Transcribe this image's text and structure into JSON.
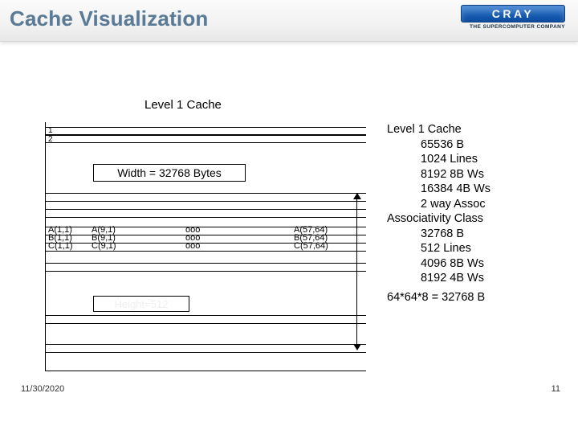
{
  "header": {
    "title": "Cache Visualization",
    "logo_text": "CRAY",
    "logo_sub": "The Supercomputer Company"
  },
  "diagram": {
    "caption": "Level 1 Cache",
    "row_numbers": [
      "1",
      "2"
    ],
    "width_label": "Width = 32768 Bytes",
    "height_label": "Height=512",
    "ellipsis": "ooo",
    "cells_left": [
      "A(1,1)",
      "B(1,1)",
      "C(1,1)"
    ],
    "cells_left2": [
      "A(9,1)",
      "B(9,1)",
      "C(9,1)"
    ],
    "cells_right": [
      "A(57,64)",
      "B(57,64)",
      "C(57,64)"
    ]
  },
  "info": {
    "heading1": "Level 1 Cache",
    "l1_size": "65536 B",
    "l1_lines": "1024 Lines",
    "l1_8b": "8192 8B Ws",
    "l1_4b": "16384 4B Ws",
    "l1_assoc": "2 way Assoc",
    "heading2": "Associativity Class",
    "ac_size": "32768 B",
    "ac_lines": "512 Lines",
    "ac_8b": "4096 8B Ws",
    "ac_4b": "8192 4B Ws"
  },
  "equation": "64*64*8 = 32768 B",
  "footer": {
    "date": "11/30/2020",
    "page": "11"
  }
}
